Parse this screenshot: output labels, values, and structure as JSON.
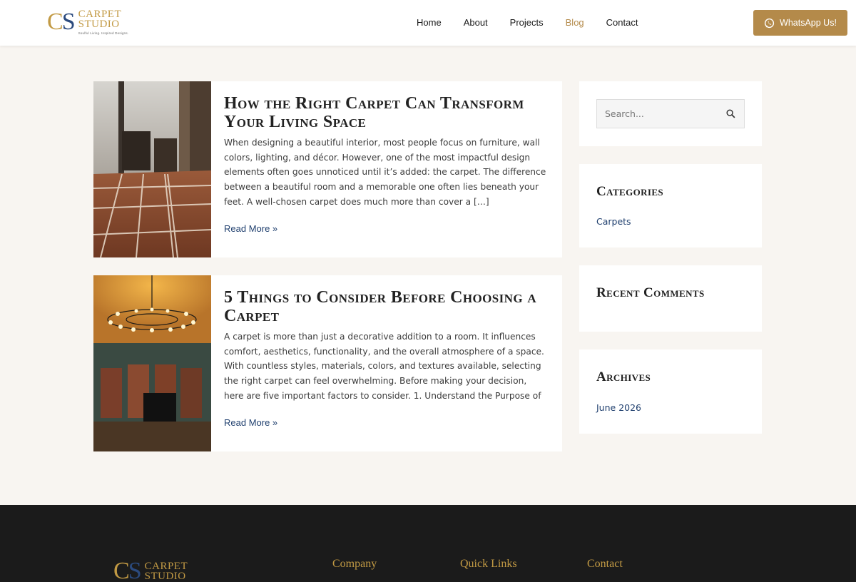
{
  "brand": {
    "monogram_c": "C",
    "monogram_s": "S",
    "word1": "CARPET",
    "word2": "STUDIO",
    "tagline": "Soulful Living. Inspired Designs."
  },
  "nav": {
    "items": [
      {
        "label": "Home"
      },
      {
        "label": "About"
      },
      {
        "label": "Projects"
      },
      {
        "label": "Blog",
        "active": true
      },
      {
        "label": "Contact"
      }
    ]
  },
  "cta": {
    "label": "WhatsApp Us!",
    "icon": "whatsapp-icon"
  },
  "posts": [
    {
      "title": "How the Right Carpet Can Transform Your Living Space",
      "excerpt": "When designing a beautiful interior, most people focus on furniture, wall colors, lighting, and décor. However, one of the most impactful design elements often goes unnoticed until it’s added: the carpet. The difference between a beautiful room and a memorable one often lies beneath your feet. A well-chosen carpet does much more than cover a […]",
      "read_more": "Read More »"
    },
    {
      "title": "5 Things to Consider Before Choosing a Carpet",
      "excerpt": "A carpet is more than just a decorative addition to a room. It influences comfort, aesthetics, functionality, and the overall atmosphere of a space. With countless styles, materials, colors, and textures available, selecting the right carpet can feel overwhelming. Before making your decision, here are five important factors to consider. 1. Understand the Purpose of",
      "read_more": "Read More »"
    }
  ],
  "sidebar": {
    "search_placeholder": "Search...",
    "categories_title": "Categories",
    "categories": [
      "Carpets"
    ],
    "recent_comments_title": "Recent Comments",
    "archives_title": "Archives",
    "archives": [
      "June 2026"
    ]
  },
  "footer": {
    "col_company": "Company",
    "col_quick_links": "Quick Links",
    "col_contact": "Contact"
  },
  "colors": {
    "accent": "#b48a4a",
    "link": "#1f3f6e",
    "footer_bg": "#1b1b1b",
    "page_bg": "#f8f5f1"
  }
}
